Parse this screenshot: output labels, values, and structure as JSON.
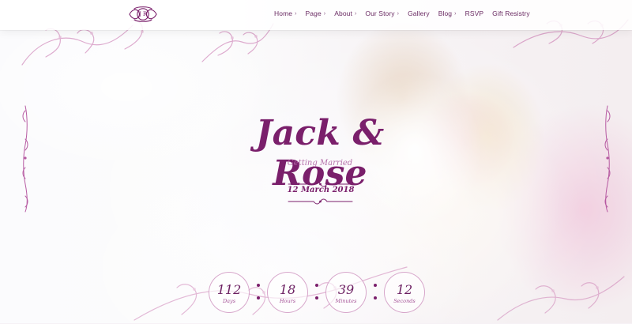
{
  "header": {
    "logo_initials": "J R",
    "nav": [
      {
        "label": "Home",
        "chevron": true
      },
      {
        "label": "Page",
        "chevron": true
      },
      {
        "label": "About",
        "chevron": true
      },
      {
        "label": "Our Story",
        "chevron": true
      },
      {
        "label": "Gallery",
        "chevron": false
      },
      {
        "label": "Blog",
        "chevron": true
      },
      {
        "label": "RSVP",
        "chevron": false
      },
      {
        "label": "Gift Resistry",
        "chevron": false
      }
    ],
    "chevron_char": "›"
  },
  "hero": {
    "title": "Jack & Rose",
    "subtitle": "Getting Married",
    "date": "12 March 2018"
  },
  "countdown": {
    "days": {
      "value": "112",
      "label": "Days"
    },
    "hours": {
      "value": "18",
      "label": "Hours"
    },
    "minutes": {
      "value": "39",
      "label": "Minutes"
    },
    "seconds": {
      "value": "12",
      "label": "Seconds"
    }
  },
  "icons": {
    "logo": "monogram-logo-icon",
    "ornament": "floral-ornament-icon",
    "divider": "decorative-divider-icon",
    "chevron": "chevron-right-icon"
  },
  "colors": {
    "accent": "#7a1f6b",
    "nav_text": "#6a2b63"
  }
}
